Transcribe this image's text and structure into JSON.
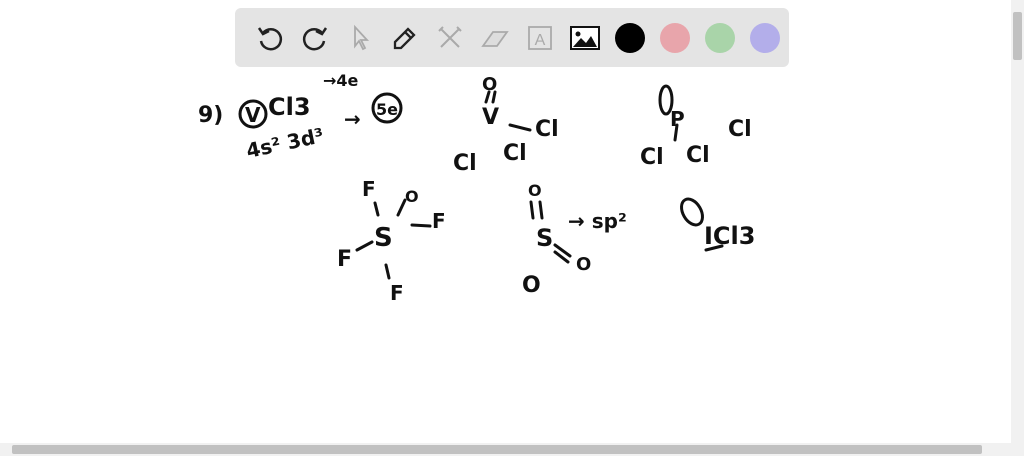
{
  "toolbar": {
    "tools": [
      {
        "name": "undo-icon",
        "label": "Undo"
      },
      {
        "name": "redo-icon",
        "label": "Redo"
      },
      {
        "name": "select-icon",
        "label": "Select"
      },
      {
        "name": "pen-icon",
        "label": "Pen"
      },
      {
        "name": "tools-icon",
        "label": "Tools"
      },
      {
        "name": "eraser-icon",
        "label": "Eraser"
      },
      {
        "name": "text-icon",
        "label": "A"
      },
      {
        "name": "image-icon",
        "label": "Image"
      }
    ],
    "colors": [
      "#000000",
      "#e8a5ab",
      "#a9d4a9",
      "#b3aeea"
    ]
  },
  "drawing": {
    "q_number": "9)",
    "v_circled": "V",
    "vcl3_rest": "Cl3",
    "arrow_4e": "→4e",
    "config": "4s² 3d³",
    "arrow_5e": "→",
    "five_e": "5e",
    "s1": {
      "o": "O",
      "bond": "||",
      "v": "V",
      "cl1": "Cl",
      "cl2": "Cl",
      "cl3": "Cl"
    },
    "s2": {
      "p": "P",
      "cl1": "Cl",
      "cl2": "Cl",
      "cl3": "Cl"
    },
    "sf4": {
      "s": "S",
      "f1": "F",
      "f2": "F",
      "f3": "F",
      "f4": "F",
      "o": "O"
    },
    "so2": {
      "s": "S",
      "o1": "O",
      "o2": "O",
      "o3": "O",
      "hyb": "→ sp²"
    },
    "icl3": {
      "label": "ICl3"
    }
  }
}
